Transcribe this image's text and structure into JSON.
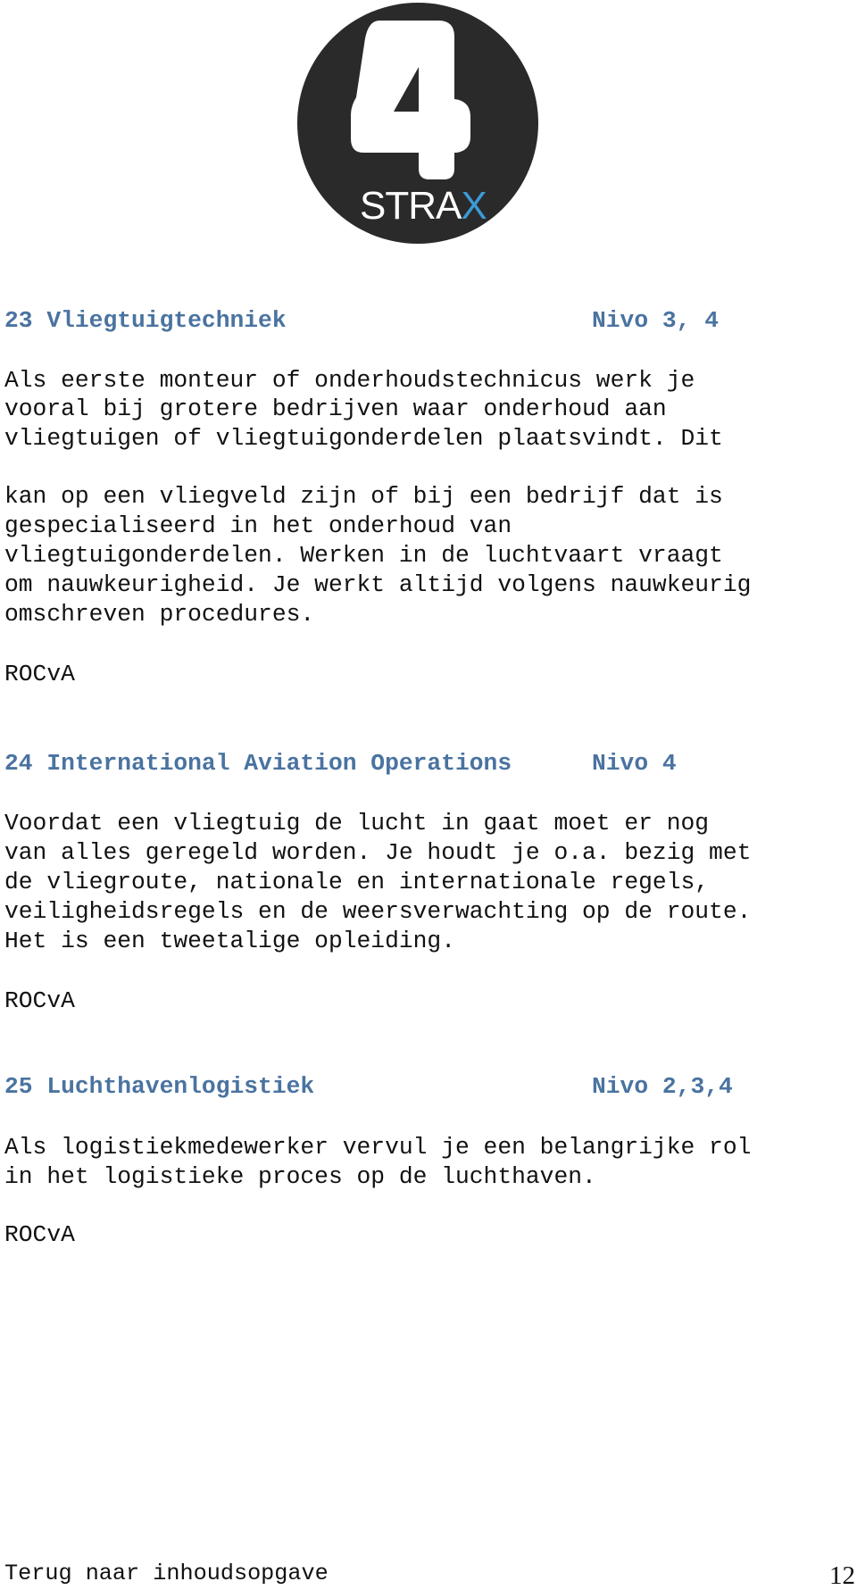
{
  "logo": {
    "numeral": "4",
    "wordmark_main": "STRA",
    "wordmark_accent": "X",
    "circle_color": "#2b2a2a",
    "accent_color": "#3b9ad8"
  },
  "sections": [
    {
      "heading": "23 Vliegtuigtechniek",
      "level": "Nivo 3, 4",
      "paragraphs": [
        [
          "Als eerste monteur of onderhoudstechnicus werk je",
          "vooral bij grotere bedrijven waar onderhoud aan",
          "vliegtuigen of vliegtuigonderdelen plaatsvindt. Dit"
        ],
        [
          "kan op een vliegveld zijn of bij een bedrijf dat is",
          "gespecialiseerd in het onderhoud van",
          "vliegtuigonderdelen. Werken in de luchtvaart vraagt",
          "om nauwkeurigheid. Je werkt altijd volgens nauwkeurig",
          "omschreven procedures."
        ]
      ],
      "provider": "ROCvA"
    },
    {
      "heading": "24 International Aviation Operations",
      "level": "Nivo 4",
      "paragraphs": [
        [
          "Voordat een vliegtuig de lucht in gaat moet er nog",
          "van alles geregeld worden. Je houdt je o.a. bezig met",
          "de vliegroute, nationale en internationale regels,",
          "veiligheidsregels en de weersverwachting op de route.",
          "Het is een tweetalige opleiding."
        ]
      ],
      "provider": "ROCvA"
    },
    {
      "heading": "25 Luchthavenlogistiek",
      "level": "Nivo 2,3,4",
      "paragraphs": [
        [
          "Als logistiekmedewerker vervul je een belangrijke rol",
          "in het logistieke proces op de luchthaven."
        ]
      ],
      "provider": "ROCvA"
    }
  ],
  "footer": {
    "back_link": "Terug naar inhoudsopgave",
    "page_number": "12"
  }
}
